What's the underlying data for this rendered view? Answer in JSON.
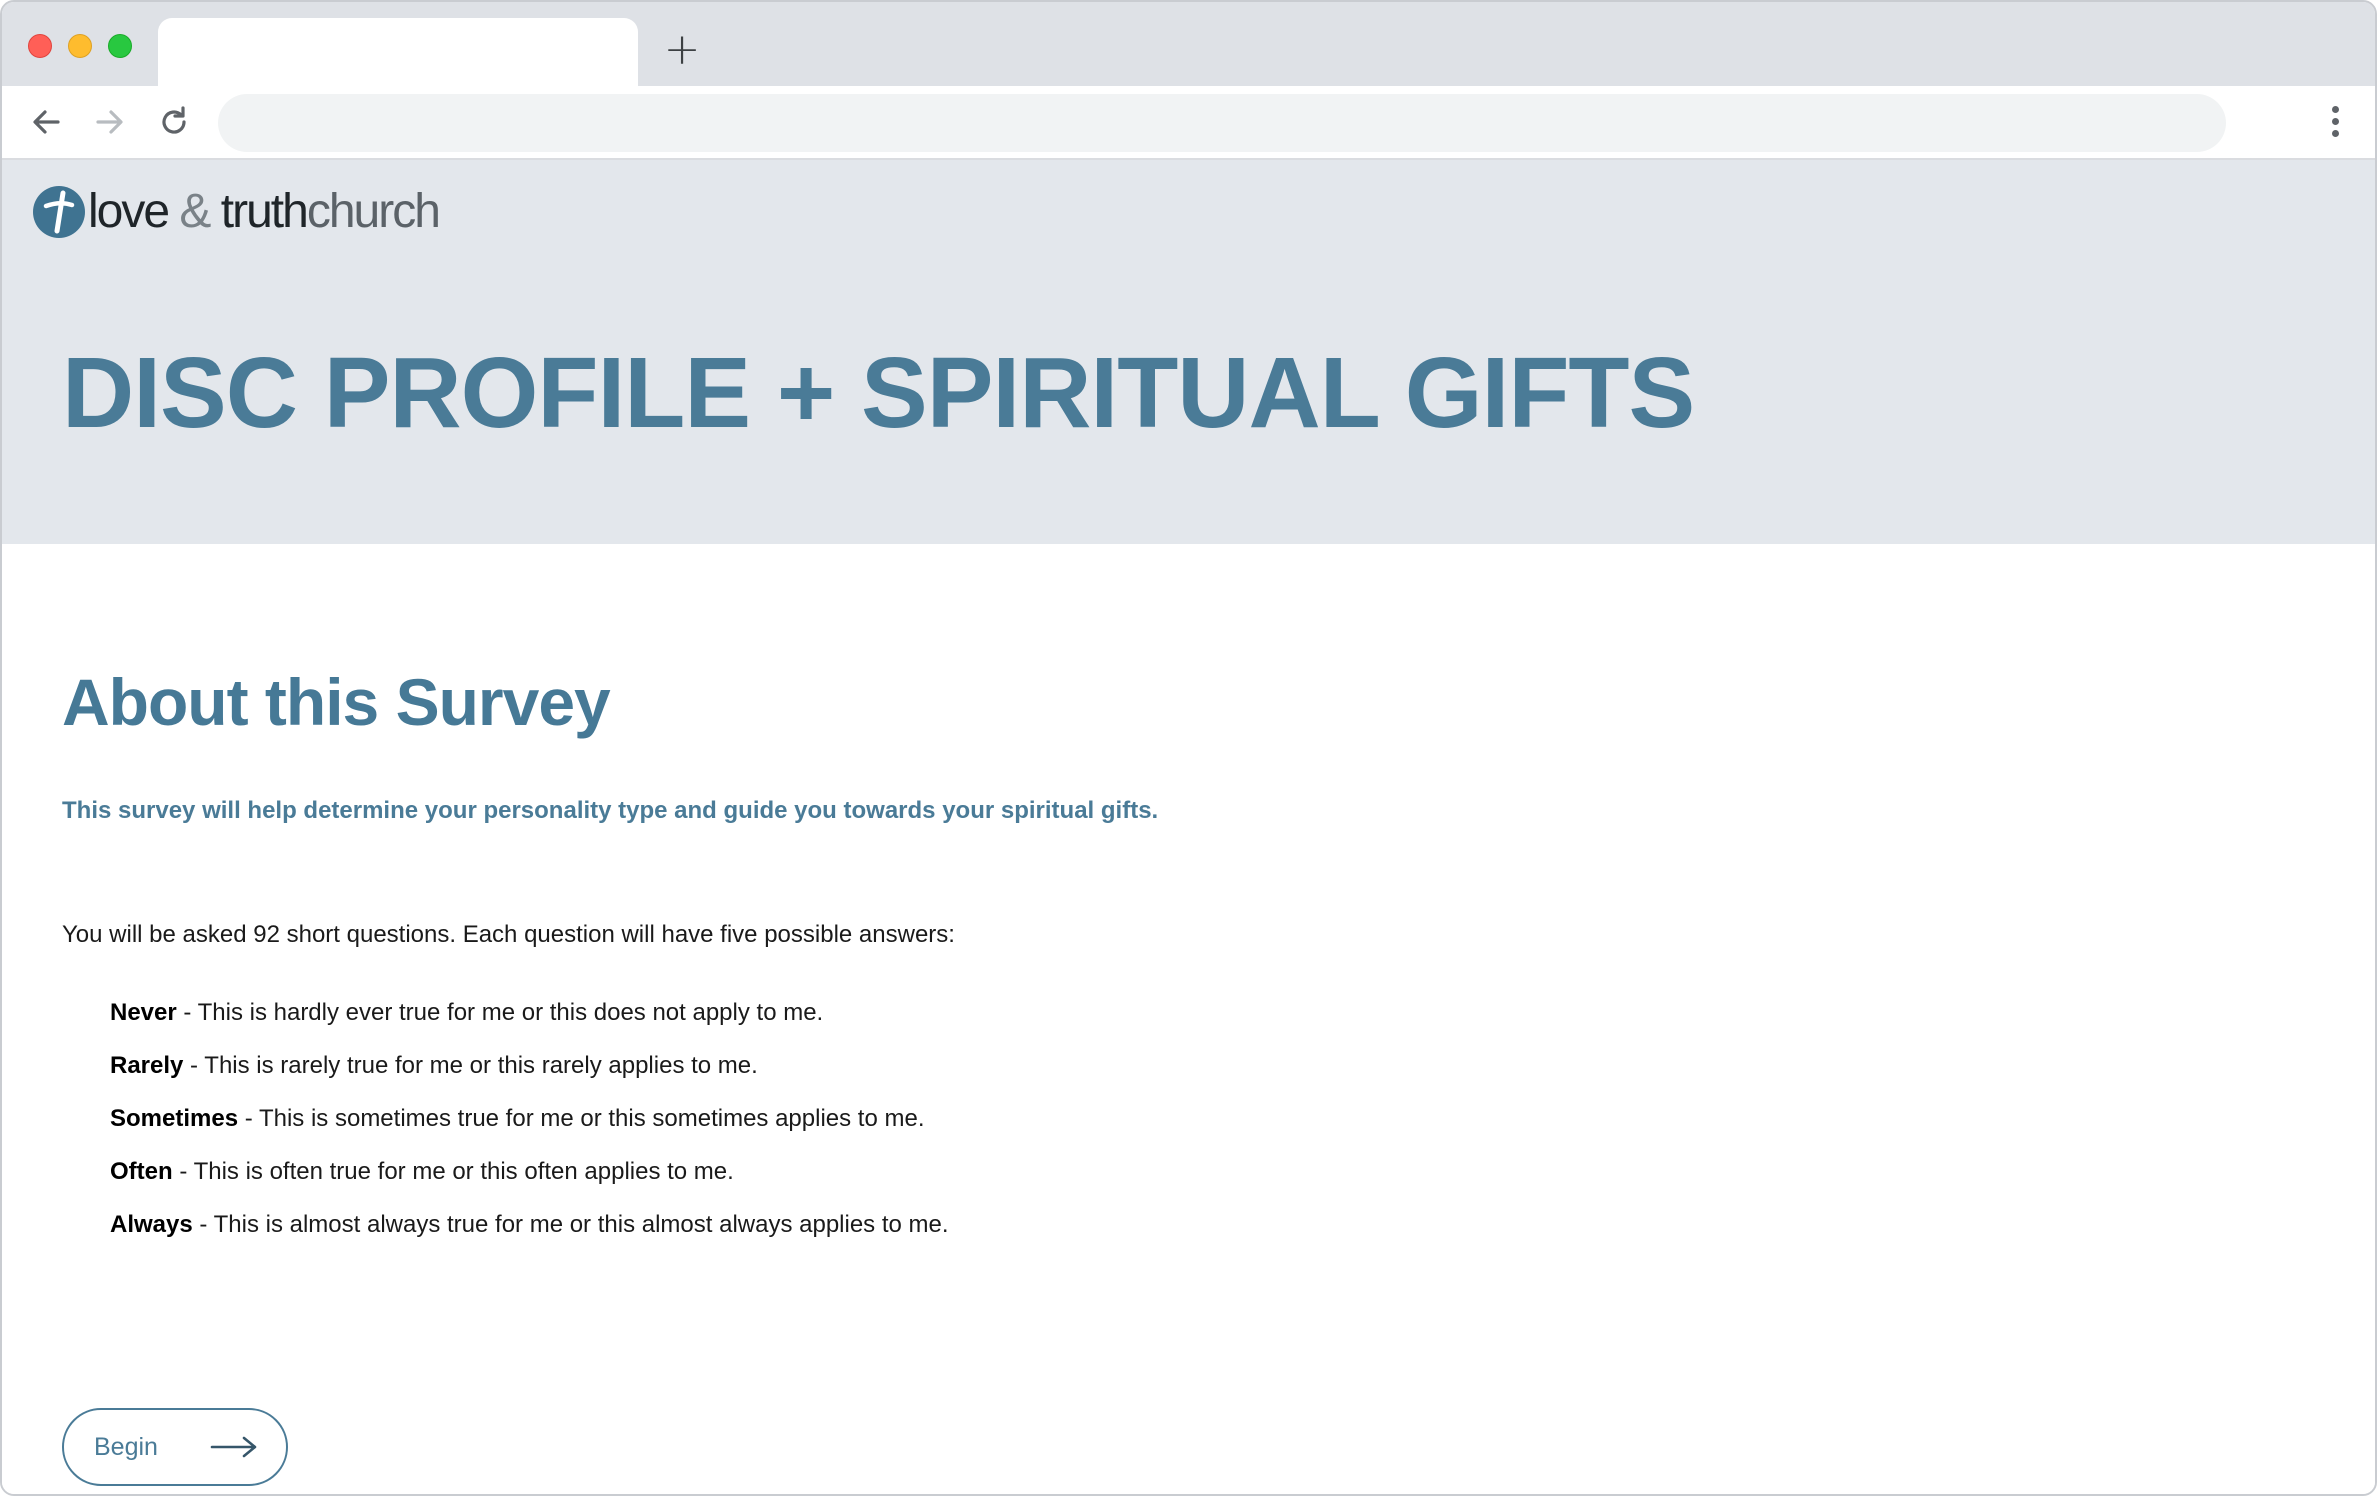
{
  "browser": {
    "tab_title": "",
    "new_tab_label": "+",
    "address_value": "",
    "icons": {
      "back": "arrow-left-icon",
      "forward": "arrow-right-icon",
      "reload": "reload-icon",
      "menu": "kebab-menu-icon",
      "new_tab": "plus-icon"
    }
  },
  "header": {
    "logo": {
      "word1": "love",
      "amp": "&",
      "word3": "truth",
      "word4": "church",
      "mark_icon": "cross-circle-icon"
    },
    "title": "DISC PROFILE + SPIRITUAL GIFTS"
  },
  "main": {
    "section_title": "About this Survey",
    "lead": "This survey will help determine your personality type and guide you towards your spiritual gifts.",
    "intro": "You will be asked 92 short questions. Each question will have five possible answers:",
    "answers": [
      {
        "term": "Never",
        "desc": " - This is hardly ever true for me or this does not apply to me."
      },
      {
        "term": "Rarely",
        "desc": " - This is rarely true for me or this rarely applies to me."
      },
      {
        "term": "Sometimes",
        "desc": " - This is sometimes true for me or this sometimes applies to me."
      },
      {
        "term": "Often",
        "desc": " - This is often true for me or this often applies to me."
      },
      {
        "term": "Always",
        "desc": " - This is almost always true for me or this almost always applies to me."
      }
    ],
    "begin_label": "Begin",
    "begin_icon": "arrow-right-long-icon"
  },
  "colors": {
    "accent": "#4a7b97",
    "hero_bg": "#e3e7ec",
    "tabstrip_bg": "#dee1e6"
  }
}
